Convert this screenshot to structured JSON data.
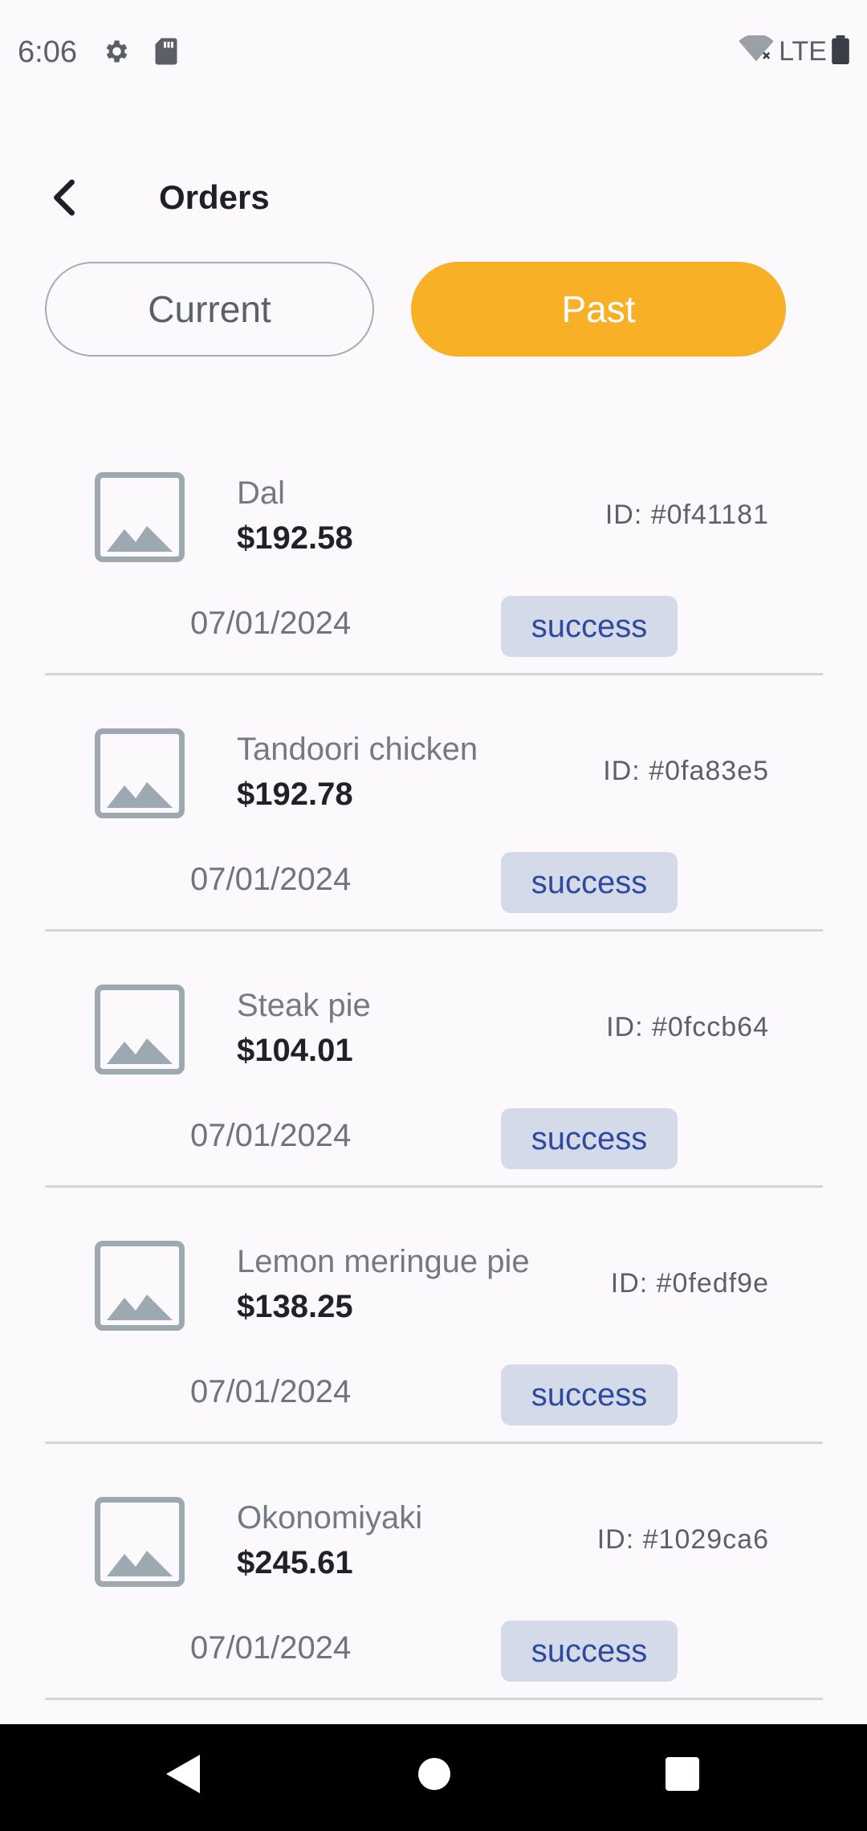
{
  "status_bar": {
    "time": "6:06",
    "network": "LTE"
  },
  "header": {
    "title": "Orders",
    "back_icon": "chevron-left-icon"
  },
  "tabs": {
    "current": "Current",
    "past": "Past",
    "active": "past",
    "active_color": "#f8b027"
  },
  "orders": [
    {
      "name": "Dal",
      "price": "$192.58",
      "id": "ID: #0f41181",
      "date": "07/01/2024",
      "status": "success"
    },
    {
      "name": "Tandoori chicken",
      "price": "$192.78",
      "id": "ID: #0fa83e5",
      "date": "07/01/2024",
      "status": "success"
    },
    {
      "name": "Steak pie",
      "price": "$104.01",
      "id": "ID: #0fccb64",
      "date": "07/01/2024",
      "status": "success"
    },
    {
      "name": "Lemon meringue pie",
      "price": "$138.25",
      "id": "ID: #0fedf9e",
      "date": "07/01/2024",
      "status": "success"
    },
    {
      "name": "Okonomiyaki",
      "price": "$245.61",
      "id": "ID: #1029ca6",
      "date": "07/01/2024",
      "status": "success"
    }
  ],
  "colors": {
    "badge_bg": "#d5dae9",
    "badge_text": "#2c4aa0",
    "background": "#fcf9fc"
  }
}
